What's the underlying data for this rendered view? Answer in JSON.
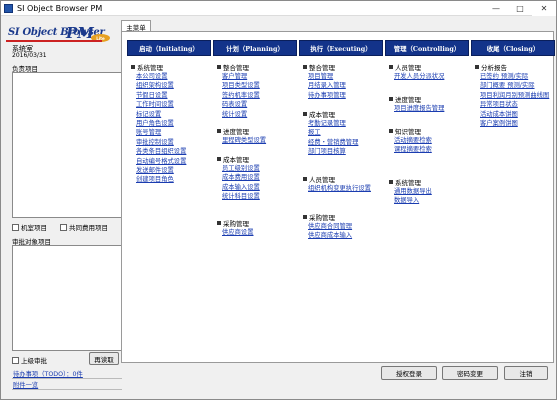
{
  "window": {
    "title": "SI Object Browser PM"
  },
  "logo": {
    "text1": "SI Object Browser",
    "text2": "PM",
    "badge": "Lite"
  },
  "user": {
    "name": "系统室",
    "date": "2016/03/31"
  },
  "left": {
    "projects_label": "负责项目",
    "chk_personal": "机室项目",
    "chk_shared": "共同费用项目",
    "review_label": "审批对象项目",
    "chk_upper": "上级审批",
    "retrieve_btn": "再读取",
    "todo_link": "待办事项（TODO）：0件",
    "attach_link": "附件一览"
  },
  "tab": {
    "label": "主菜单"
  },
  "columns": [
    {
      "header": "启动（Initiating）",
      "groups": [
        {
          "title": "系统管理",
          "items": [
            "本公司设置",
            "组织架构设置",
            "节假日设置",
            "工作时间设置",
            "标记设置",
            "用户角色设置",
            "账号管理",
            "审批控制设置",
            "各类条目组织设置",
            "自动编号格式设置",
            "发送邮件设置",
            "创建项目角色"
          ]
        }
      ]
    },
    {
      "header": "计划（Planning）",
      "groups": [
        {
          "title": "整合管理",
          "items": [
            "客户管理",
            "项目类型设置",
            "签约机率设置",
            "码表设置",
            "统计设置"
          ]
        },
        {
          "title": "进度管理",
          "items": [
            "里程碑类型设置"
          ]
        },
        {
          "title": "成本管理",
          "items": [
            "员工级别设置",
            "成本费用设置",
            "成本输入设置",
            "统计科目设置"
          ]
        },
        {
          "title": "采购管理",
          "items": [
            "供应商设置"
          ]
        }
      ]
    },
    {
      "header": "执行（Executing）",
      "groups": [
        {
          "title": "整合管理",
          "items": [
            "项目管理",
            "月结录入管理",
            "待办事项管理"
          ]
        },
        {
          "title": "成本管理",
          "items": [
            "考勤记录管理",
            "报工",
            "经费・营销费管理",
            "部门项目核算"
          ]
        },
        {
          "title": "人员管理",
          "items": [
            "组织机构变更执行设置"
          ]
        },
        {
          "title": "采购管理",
          "items": [
            "供应商合同管理",
            "供应商成本输入"
          ]
        }
      ]
    },
    {
      "header": "管理（Controlling）",
      "groups": [
        {
          "title": "人员管理",
          "items": [
            "开发人员分派状况"
          ]
        },
        {
          "title": "进度管理",
          "items": [
            "项目进度报告管理"
          ]
        },
        {
          "title": "知识管理",
          "items": [
            "活动摘要检索",
            "课程摘要检索"
          ]
        },
        {
          "title": "系统管理",
          "items": [
            "通用数据导出",
            "数据导入"
          ]
        }
      ]
    },
    {
      "header": "收尾（Closing）",
      "groups": [
        {
          "title": "分析报告",
          "items": [
            "已签约 预测/实际",
            "部门概要 预测/实际",
            "项目利润月别预测曲线图",
            "异常项目状态",
            "活动成本饼图",
            "客户案例饼图"
          ]
        }
      ]
    }
  ],
  "footer": {
    "pwd_login": "授权登录",
    "pwd_change": "密码变更",
    "cancel": "注销"
  }
}
